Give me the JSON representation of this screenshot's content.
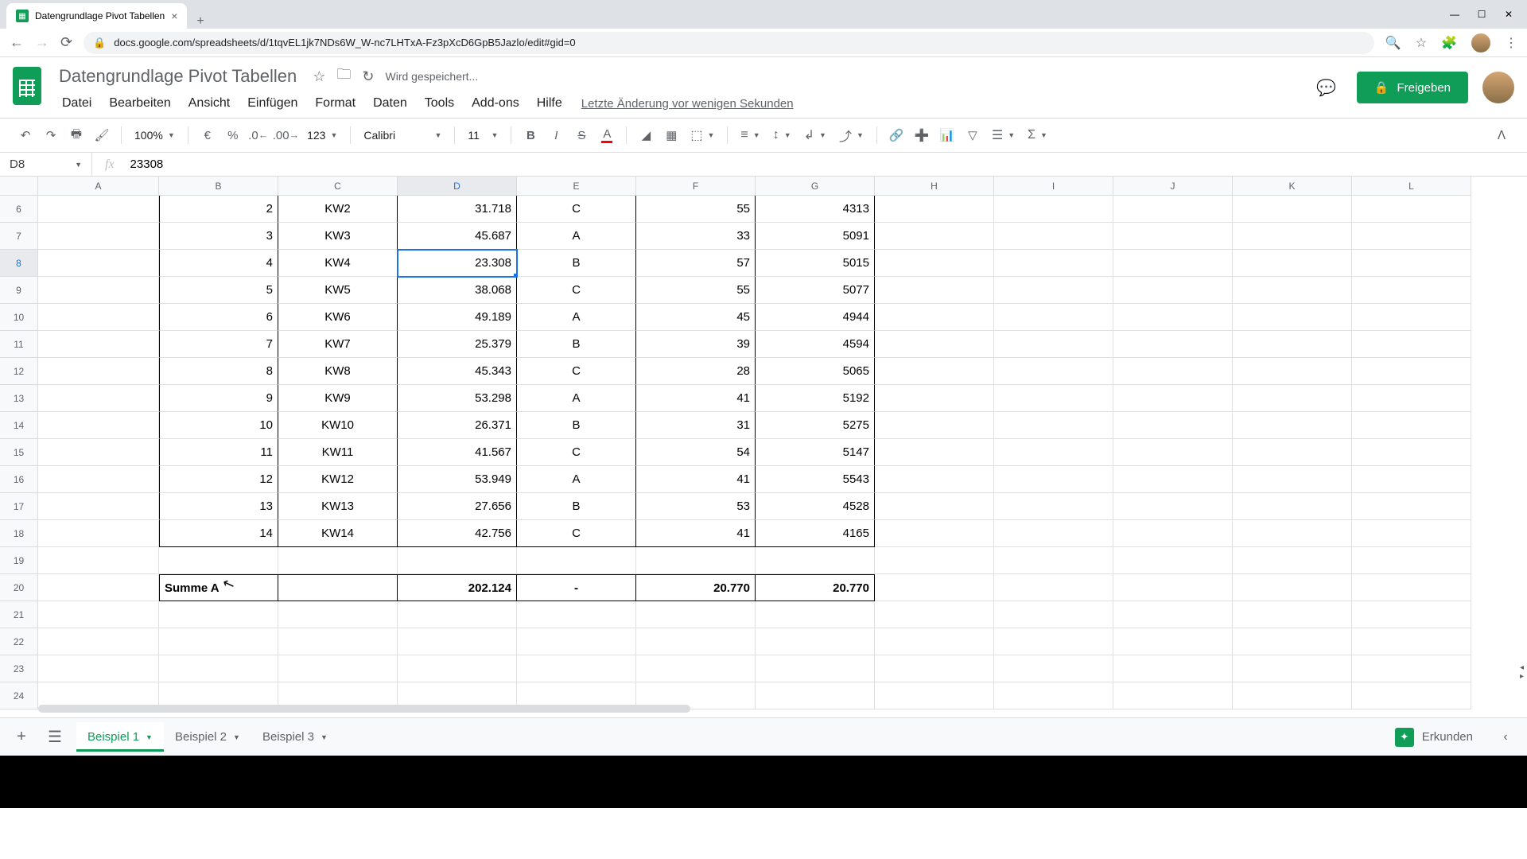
{
  "browser": {
    "tab_title": "Datengrundlage Pivot Tabellen",
    "url_display": "docs.google.com/spreadsheets/d/1tqvEL1jk7NDs6W_W-nc7LHTxA-Fz3pXcD6GpB5Jazlo/edit#gid=0"
  },
  "header": {
    "doc_title": "Datengrundlage Pivot Tabellen",
    "save_status": "Wird gespeichert...",
    "last_edit": "Letzte Änderung vor wenigen Sekunden",
    "share_label": "Freigeben",
    "menu": {
      "file": "Datei",
      "edit": "Bearbeiten",
      "view": "Ansicht",
      "insert": "Einfügen",
      "format": "Format",
      "data": "Daten",
      "tools": "Tools",
      "addons": "Add-ons",
      "help": "Hilfe"
    }
  },
  "toolbar": {
    "zoom": "100%",
    "currency": "€",
    "percent": "%",
    "dec_dec": ".0",
    "inc_dec": ".00",
    "numformat": "123",
    "font": "Calibri",
    "fontsize": "11"
  },
  "formula_bar": {
    "cell_ref": "D8",
    "fx_label": "fx",
    "value": "23308"
  },
  "grid": {
    "col_widths": {
      "A": 152,
      "B": 150,
      "C": 150,
      "D": 150,
      "E": 150,
      "F": 150,
      "G": 150,
      "H": 150,
      "I": 150,
      "J": 150,
      "K": 150,
      "L": 150
    },
    "columns": [
      "A",
      "B",
      "C",
      "D",
      "E",
      "F",
      "G",
      "H",
      "I",
      "J",
      "K",
      "L"
    ],
    "selected_col": "D",
    "selected_row": 8,
    "row_numbers": [
      6,
      7,
      8,
      9,
      10,
      11,
      12,
      13,
      14,
      15,
      16,
      17,
      18,
      19,
      20,
      21,
      22,
      23,
      24
    ],
    "data_rows": [
      {
        "r": 6,
        "B": "2",
        "C": "KW2",
        "D": "31.718",
        "E": "C",
        "F": "55",
        "G": "4313"
      },
      {
        "r": 7,
        "B": "3",
        "C": "KW3",
        "D": "45.687",
        "E": "A",
        "F": "33",
        "G": "5091"
      },
      {
        "r": 8,
        "B": "4",
        "C": "KW4",
        "D": "23.308",
        "E": "B",
        "F": "57",
        "G": "5015"
      },
      {
        "r": 9,
        "B": "5",
        "C": "KW5",
        "D": "38.068",
        "E": "C",
        "F": "55",
        "G": "5077"
      },
      {
        "r": 10,
        "B": "6",
        "C": "KW6",
        "D": "49.189",
        "E": "A",
        "F": "45",
        "G": "4944"
      },
      {
        "r": 11,
        "B": "7",
        "C": "KW7",
        "D": "25.379",
        "E": "B",
        "F": "39",
        "G": "4594"
      },
      {
        "r": 12,
        "B": "8",
        "C": "KW8",
        "D": "45.343",
        "E": "C",
        "F": "28",
        "G": "5065"
      },
      {
        "r": 13,
        "B": "9",
        "C": "KW9",
        "D": "53.298",
        "E": "A",
        "F": "41",
        "G": "5192"
      },
      {
        "r": 14,
        "B": "10",
        "C": "KW10",
        "D": "26.371",
        "E": "B",
        "F": "31",
        "G": "5275"
      },
      {
        "r": 15,
        "B": "11",
        "C": "KW11",
        "D": "41.567",
        "E": "C",
        "F": "54",
        "G": "5147"
      },
      {
        "r": 16,
        "B": "12",
        "C": "KW12",
        "D": "53.949",
        "E": "A",
        "F": "41",
        "G": "5543"
      },
      {
        "r": 17,
        "B": "13",
        "C": "KW13",
        "D": "27.656",
        "E": "B",
        "F": "53",
        "G": "4528"
      },
      {
        "r": 18,
        "B": "14",
        "C": "KW14",
        "D": "42.756",
        "E": "C",
        "F": "41",
        "G": "4165"
      }
    ],
    "summary_row": {
      "r": 20,
      "B": "Summe A",
      "D": "202.124",
      "E": "-",
      "F": "20.770",
      "G": "20.770"
    }
  },
  "sheets": {
    "add_tooltip": "+",
    "tabs": [
      {
        "label": "Beispiel 1",
        "active": true
      },
      {
        "label": "Beispiel 2",
        "active": false
      },
      {
        "label": "Beispiel 3",
        "active": false
      }
    ],
    "explore_label": "Erkunden"
  }
}
